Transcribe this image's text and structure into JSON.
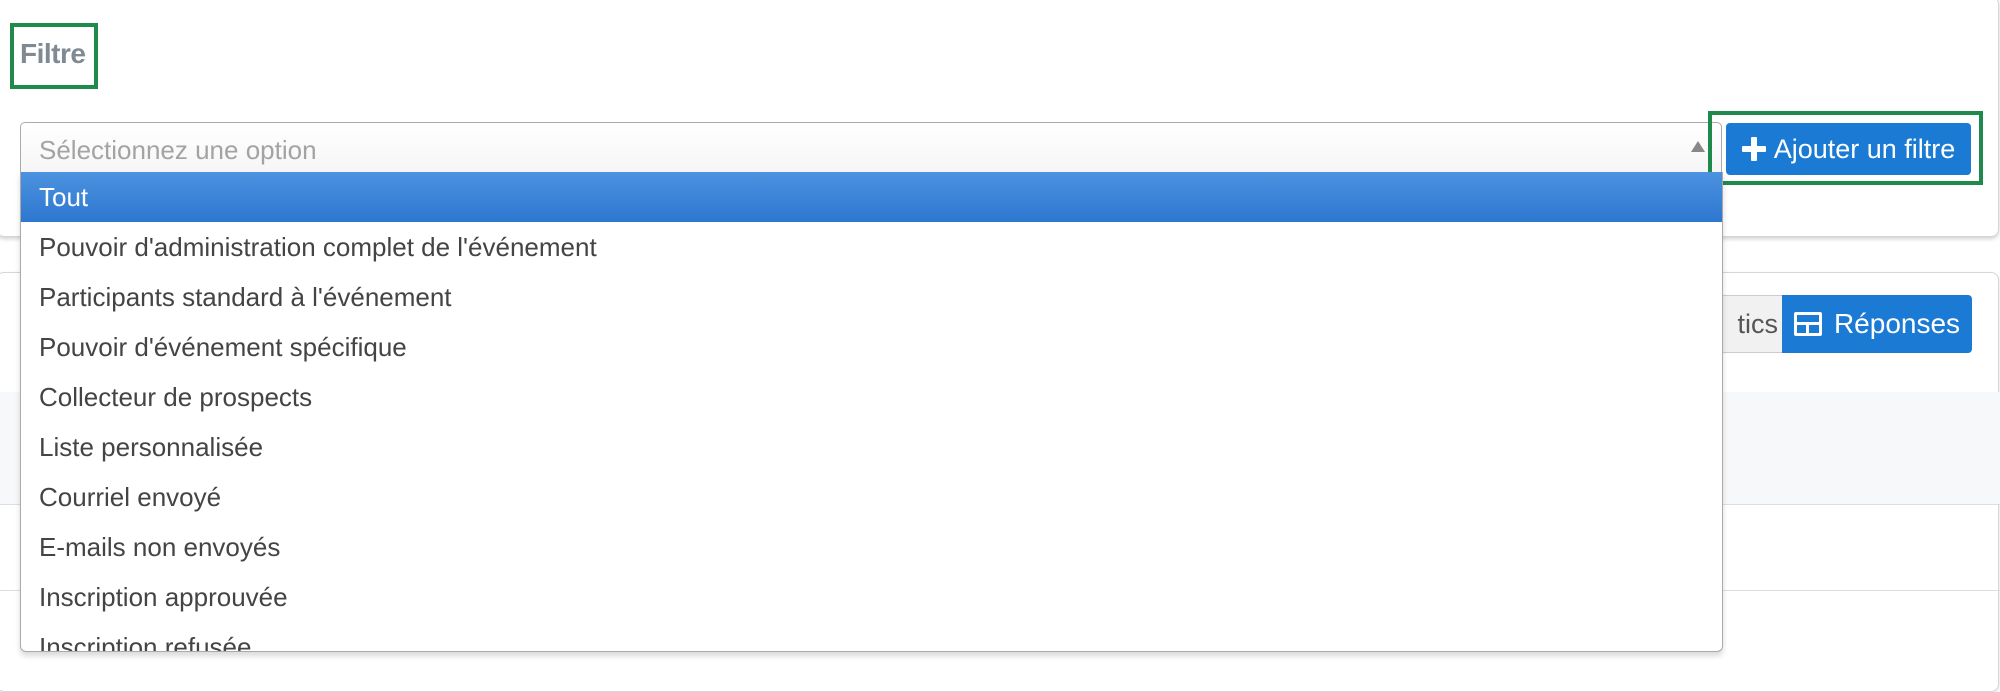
{
  "filter": {
    "title": "Filtre",
    "select_placeholder": "Sélectionnez une option",
    "add_button_label": "Ajouter un filtre",
    "options": [
      "Tout",
      "Pouvoir d'administration complet de l'événement",
      "Participants standard à l'événement",
      "Pouvoir d'événement spécifique",
      "Collecteur de prospects",
      "Liste personnalisée",
      "Courriel envoyé",
      "E-mails non envoyés",
      "Inscription approuvée",
      "Inscription refusée"
    ],
    "selected_option": "Tout"
  },
  "results": {
    "stats_label_partial": "tics",
    "responses_label": "Réponses"
  },
  "colors": {
    "accent": "#1a7ad4",
    "highlight": "#1f8a4c",
    "selected_option": "#3a84d8"
  },
  "icons": {
    "add": "plus-icon",
    "responses": "table-grid-icon",
    "select": "triangle-up-icon"
  }
}
